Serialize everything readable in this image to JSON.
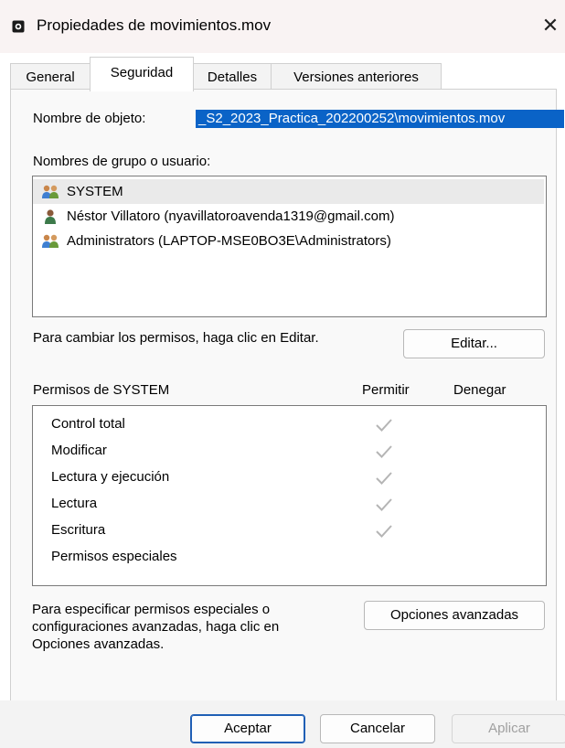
{
  "window": {
    "title": "Propiedades de movimientos.mov",
    "close_glyph": "✕"
  },
  "tabs": [
    {
      "label": "General",
      "active": false
    },
    {
      "label": "Seguridad",
      "active": true
    },
    {
      "label": "Detalles",
      "active": false
    },
    {
      "label": "Versiones anteriores",
      "active": false
    }
  ],
  "security": {
    "object_name_label": "Nombre de objeto:",
    "object_name_value": "_S2_2023_Practica_202200252\\movimientos.mov",
    "groups_label": "Nombres de grupo o usuario:",
    "groups": [
      {
        "name": "SYSTEM",
        "icon": "users-group-icon",
        "selected": true
      },
      {
        "name": "Néstor Villatoro (nyavillatoroavenda1319@gmail.com)",
        "icon": "user-icon",
        "selected": false
      },
      {
        "name": "Administrators (LAPTOP-MSE0BO3E\\Administrators)",
        "icon": "users-group-icon",
        "selected": false
      }
    ],
    "change_hint": "Para cambiar los permisos, haga clic en Editar.",
    "edit_button": "Editar...",
    "permissions_label": "Permisos de SYSTEM",
    "allow_header": "Permitir",
    "deny_header": "Denegar",
    "permissions": [
      {
        "name": "Control total",
        "allow": true,
        "deny": false
      },
      {
        "name": "Modificar",
        "allow": true,
        "deny": false
      },
      {
        "name": "Lectura y ejecución",
        "allow": true,
        "deny": false
      },
      {
        "name": "Lectura",
        "allow": true,
        "deny": false
      },
      {
        "name": "Escritura",
        "allow": true,
        "deny": false
      },
      {
        "name": "Permisos especiales",
        "allow": false,
        "deny": false
      }
    ],
    "advanced_note_line1": "Para especificar permisos especiales o",
    "advanced_note_line2": "configuraciones avanzadas, haga clic en",
    "advanced_note_line3": "Opciones avanzadas.",
    "advanced_button": "Opciones avanzadas"
  },
  "footer": {
    "ok": "Aceptar",
    "cancel": "Cancelar",
    "apply": "Aplicar"
  },
  "colors": {
    "selection": "#0a63c7",
    "check_gray": "#b5b5b5",
    "group_icon_a": "#3f7fd1",
    "group_icon_b": "#6a9a3a"
  }
}
